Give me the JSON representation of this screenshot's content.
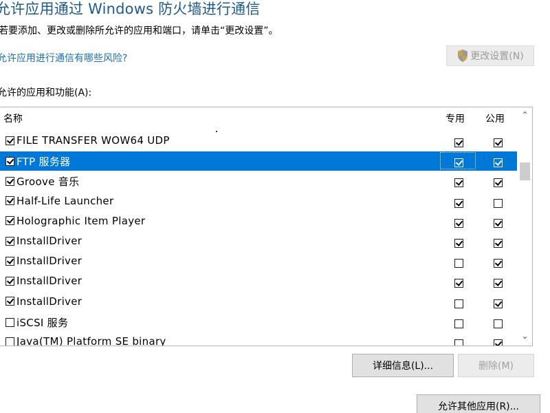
{
  "window": {
    "title": "允许应用通过 Windows 防火墙进行通信",
    "instruction": "若要添加、更改或删除所允许的应用和端口，请单击“更改设置”。",
    "risk_link": "允许应用进行通信有哪些风险?",
    "change_settings_label": "更改设置(N)",
    "list_label": "允许的应用和功能(A):"
  },
  "columns": {
    "name": "名称",
    "private": "专用",
    "public": "公用"
  },
  "apps": [
    {
      "name": "FILE TRANSFER WOW64 UDP",
      "enabled": true,
      "private": true,
      "public": true,
      "selected": false
    },
    {
      "name": "FTP 服务器",
      "enabled": true,
      "private": true,
      "public": true,
      "selected": true
    },
    {
      "name": "Groove 音乐",
      "enabled": true,
      "private": true,
      "public": true,
      "selected": false
    },
    {
      "name": "Half-Life Launcher",
      "enabled": true,
      "private": true,
      "public": false,
      "selected": false
    },
    {
      "name": "Holographic Item Player",
      "enabled": true,
      "private": true,
      "public": true,
      "selected": false
    },
    {
      "name": "InstallDriver",
      "enabled": true,
      "private": true,
      "public": true,
      "selected": false
    },
    {
      "name": "InstallDriver",
      "enabled": true,
      "private": false,
      "public": true,
      "selected": false
    },
    {
      "name": "InstallDriver",
      "enabled": true,
      "private": true,
      "public": true,
      "selected": false
    },
    {
      "name": "InstallDriver",
      "enabled": true,
      "private": false,
      "public": true,
      "selected": false
    },
    {
      "name": "iSCSI 服务",
      "enabled": false,
      "private": false,
      "public": false,
      "selected": false
    },
    {
      "name": "Java(TM) Platform SE binary",
      "enabled": false,
      "private": false,
      "public": true,
      "selected": false
    }
  ],
  "buttons": {
    "details": "详细信息(L)...",
    "remove": "删除(M)",
    "allow_other": "允许其他应用(R)..."
  },
  "icons": {
    "shield": "uac-shield-icon",
    "scroll_up": "chevron-up-icon",
    "scroll_down": "chevron-down-icon"
  },
  "colors": {
    "title": "#1d5a8e",
    "link": "#1a6fb0",
    "selection": "#0078d7"
  }
}
